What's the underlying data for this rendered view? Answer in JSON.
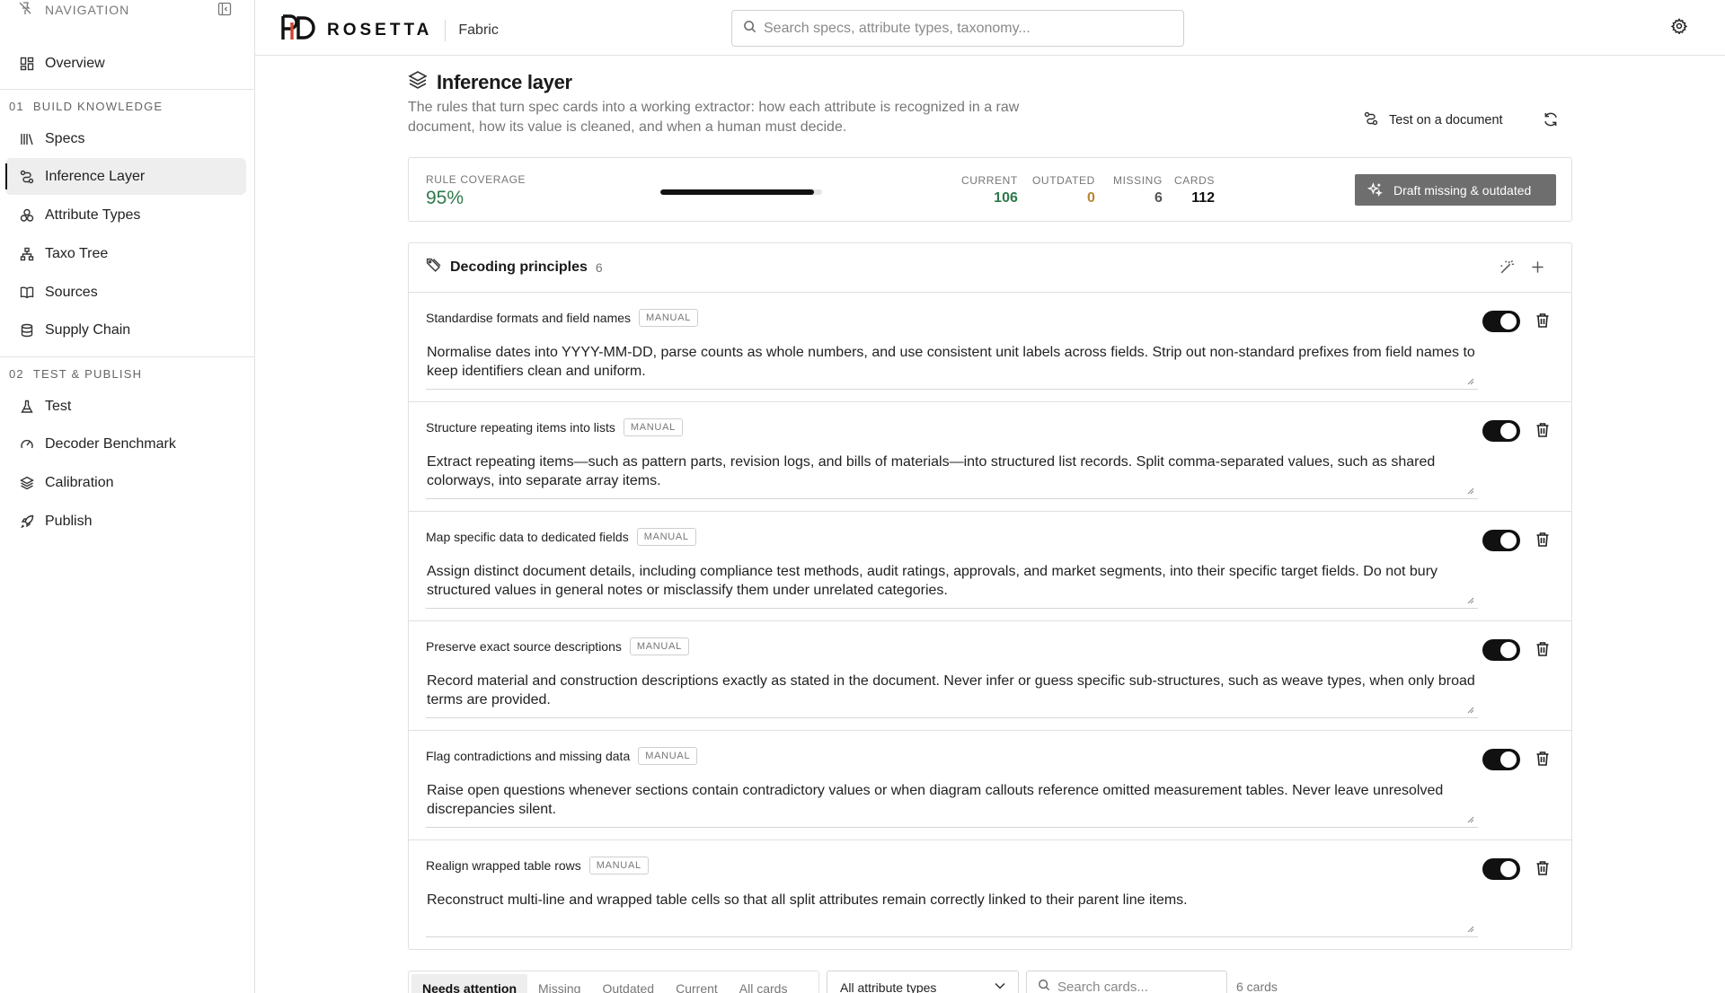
{
  "sidebar": {
    "header": "NAVIGATION",
    "items": [
      {
        "label": "Overview",
        "icon": "grid-icon"
      },
      {
        "label": "Specs",
        "icon": "library-icon"
      },
      {
        "label": "Inference Layer",
        "icon": "route-icon"
      },
      {
        "label": "Attribute Types",
        "icon": "shapes-icon"
      },
      {
        "label": "Taxo Tree",
        "icon": "tree-icon"
      },
      {
        "label": "Sources",
        "icon": "book-icon"
      },
      {
        "label": "Supply Chain",
        "icon": "database-icon"
      },
      {
        "label": "Test",
        "icon": "flask-icon"
      },
      {
        "label": "Decoder Benchmark",
        "icon": "gauge-icon"
      },
      {
        "label": "Calibration",
        "icon": "layers-icon"
      },
      {
        "label": "Publish",
        "icon": "rocket-icon"
      }
    ],
    "sections": [
      {
        "num": "01",
        "label": "BUILD KNOWLEDGE"
      },
      {
        "num": "02",
        "label": "TEST & PUBLISH"
      }
    ],
    "active": "Inference Layer"
  },
  "topbar": {
    "brand": "ROSETTA",
    "workspace": "Fabric",
    "search_placeholder": "Search specs, attribute types, taxonomy..."
  },
  "page": {
    "title": "Inference layer",
    "description": "The rules that turn spec cards into a working extractor: how each attribute is recognized in a raw document, how its value is cleaned, and when a human must decide.",
    "test_button": "Test on a document"
  },
  "coverage": {
    "label": "RULE COVERAGE",
    "value": "95%",
    "fraction": 0.95,
    "stats": [
      {
        "key": "CURRENT",
        "value": "106",
        "color": "#2e7a4a"
      },
      {
        "key": "OUTDATED",
        "value": "0",
        "color": "#b8862f"
      },
      {
        "key": "MISSING",
        "value": "6",
        "color": "#555555"
      },
      {
        "key": "CARDS",
        "value": "112",
        "color": "#111111"
      }
    ],
    "draft_button": "Draft missing & outdated"
  },
  "principles": {
    "title": "Decoding principles",
    "count": "6",
    "rules": [
      {
        "name": "Standardise formats and field names",
        "badge": "MANUAL",
        "text": "Normalise dates into YYYY-MM-DD, parse counts as whole numbers, and use consistent unit labels across fields. Strip out non-standard prefixes from field names to keep identifiers clean and uniform.",
        "enabled": true
      },
      {
        "name": "Structure repeating items into lists",
        "badge": "MANUAL",
        "text": "Extract repeating items—such as pattern parts, revision logs, and bills of materials—into structured list records. Split comma-separated values, such as shared colorways, into separate array items.",
        "enabled": true
      },
      {
        "name": "Map specific data to dedicated fields",
        "badge": "MANUAL",
        "text": "Assign distinct document details, including compliance test methods, audit ratings, approvals, and market segments, into their specific target fields. Do not bury structured values in general notes or misclassify them under unrelated categories.",
        "enabled": true
      },
      {
        "name": "Preserve exact source descriptions",
        "badge": "MANUAL",
        "text": "Record material and construction descriptions exactly as stated in the document. Never infer or guess specific sub-structures, such as weave types, when only broad terms are provided.",
        "enabled": true
      },
      {
        "name": "Flag contradictions and missing data",
        "badge": "MANUAL",
        "text": "Raise open questions whenever sections contain contradictory values or when diagram callouts reference omitted measurement tables. Never leave unresolved discrepancies silent.",
        "enabled": true
      },
      {
        "name": "Realign wrapped table rows",
        "badge": "MANUAL",
        "text": "Reconstruct multi-line and wrapped table cells so that all split attributes remain correctly linked to their parent line items.",
        "enabled": true
      }
    ]
  },
  "filters": {
    "tabs": [
      "Needs attention",
      "Missing",
      "Outdated",
      "Current",
      "All cards"
    ],
    "active_tab": "Needs attention",
    "attribute_select": "All attribute types",
    "search_placeholder": "Search cards...",
    "count": "6 cards"
  }
}
